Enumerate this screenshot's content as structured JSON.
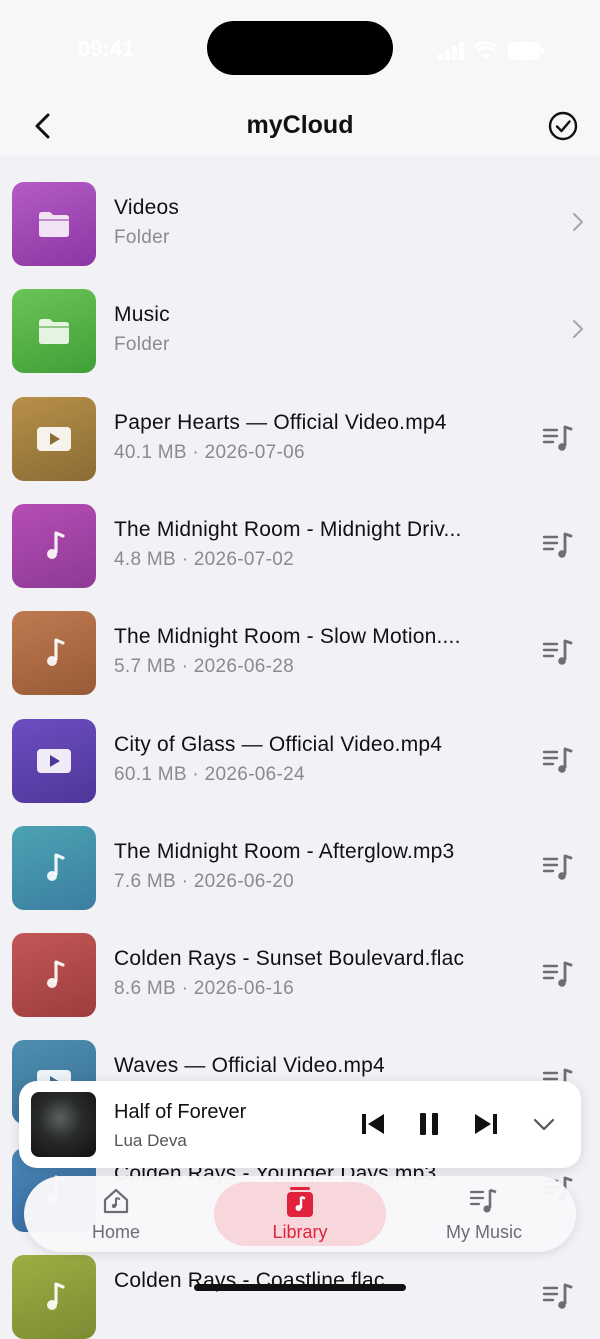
{
  "status_bar": {
    "time": "09:41"
  },
  "nav": {
    "title": "myCloud"
  },
  "items": [
    {
      "name": "Videos",
      "sub": "Folder",
      "kind": "folder",
      "color_a": "#b45bc6",
      "color_b": "#8b36a3"
    },
    {
      "name": "Music",
      "sub": "Folder",
      "kind": "folder",
      "color_a": "#6cc457",
      "color_b": "#3f9f36"
    },
    {
      "name": "Paper Hearts — Official Video.mp4",
      "sub": "40.1 MB · 2026-07-06",
      "kind": "video",
      "color_a": "#b89049",
      "color_b": "#8a6c34"
    },
    {
      "name": "The Midnight Room - Midnight Driv...",
      "sub": "4.8 MB · 2026-07-02",
      "kind": "audio",
      "color_a": "#b54db5",
      "color_b": "#8e3a96"
    },
    {
      "name": "The Midnight Room - Slow Motion....",
      "sub": "5.7 MB · 2026-06-28",
      "kind": "audio",
      "color_a": "#bf7a52",
      "color_b": "#985a37"
    },
    {
      "name": "City of Glass — Official Video.mp4",
      "sub": "60.1 MB · 2026-06-24",
      "kind": "video",
      "color_a": "#6d4ec0",
      "color_b": "#4e3699"
    },
    {
      "name": "The Midnight Room - Afterglow.mp3",
      "sub": "7.6 MB · 2026-06-20",
      "kind": "audio",
      "color_a": "#4ca3b3",
      "color_b": "#3a7ea0"
    },
    {
      "name": "Colden Rays - Sunset Boulevard.flac",
      "sub": "8.6 MB · 2026-06-16",
      "kind": "audio",
      "color_a": "#c45757",
      "color_b": "#9c3d3d"
    },
    {
      "name": "Waves — Official Video.mp4",
      "sub": "",
      "kind": "video",
      "color_a": "#4d8fb0",
      "color_b": "#3a6e95"
    },
    {
      "name": "Colden Rays - Younger Days.mp3",
      "sub": "",
      "kind": "audio",
      "color_a": "#4b86b5",
      "color_b": "#3668a0"
    },
    {
      "name": "Colden Rays - Coastline.flac",
      "sub": "",
      "kind": "audio",
      "color_a": "#9eae44",
      "color_b": "#7c8c32"
    }
  ],
  "mini_player": {
    "title": "Half of Forever",
    "artist": "Lua Deva"
  },
  "tab_bar": {
    "tabs": [
      {
        "label": "Home",
        "icon": "home-icon"
      },
      {
        "label": "Library",
        "icon": "library-icon"
      },
      {
        "label": "My Music",
        "icon": "my-music-icon"
      }
    ],
    "active_index": 1
  },
  "colors": {
    "accent": "#e0233a",
    "accent_bg": "#f7d6dc"
  }
}
